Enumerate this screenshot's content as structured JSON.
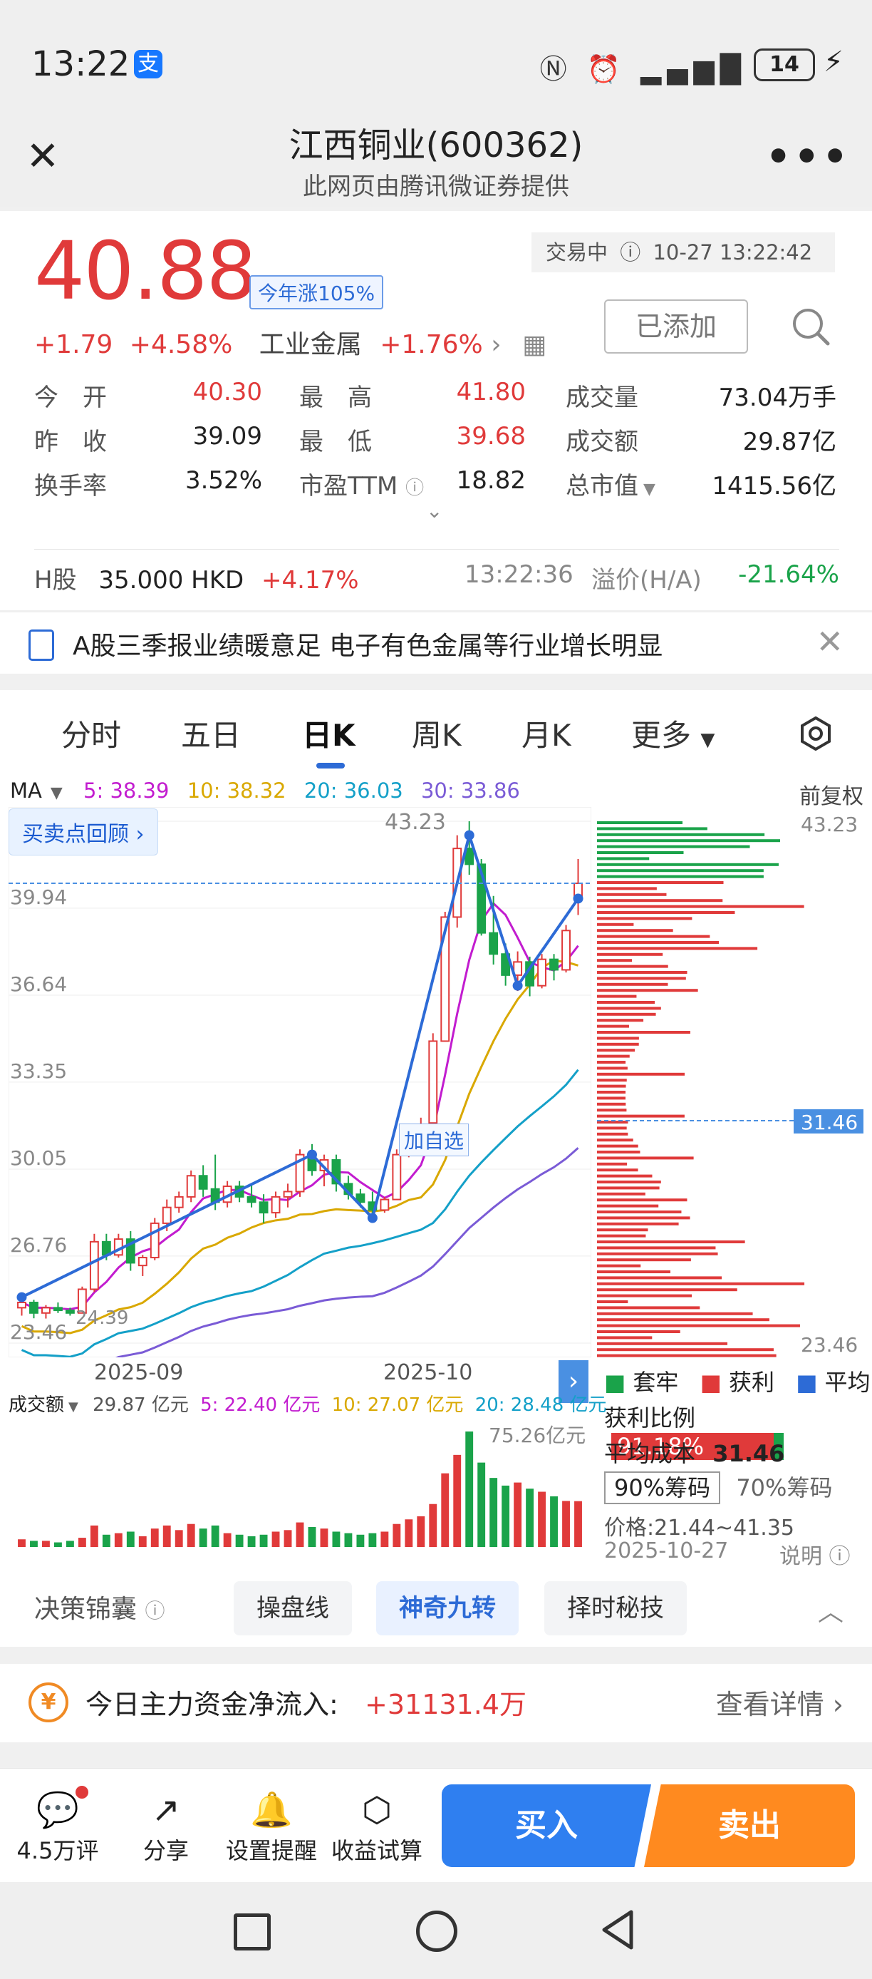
{
  "status_bar": {
    "time": "13:22",
    "app_badge": "支",
    "battery": "14"
  },
  "header": {
    "title": "江西铜业(600362)",
    "subtitle": "此网页由腾讯微证券提供"
  },
  "quote": {
    "price": "40.88",
    "ytd": "今年涨105%",
    "status": "交易中",
    "datetime": "10-27 13:22:42",
    "change": "+1.79",
    "change_pct": "+4.58%",
    "sector": "工业金属",
    "sector_pct": "+1.76%",
    "added_label": "已添加",
    "stats": [
      {
        "label": "今　开",
        "value": "40.30",
        "color": "red"
      },
      {
        "label": "最　高",
        "value": "41.80",
        "color": "red"
      },
      {
        "label": "成交量",
        "value": "73.04万手",
        "color": "black"
      },
      {
        "label": "昨　收",
        "value": "39.09",
        "color": "black"
      },
      {
        "label": "最　低",
        "value": "39.68",
        "color": "red"
      },
      {
        "label": "成交额",
        "value": "29.87亿",
        "color": "black"
      },
      {
        "label": "换手率",
        "value": "3.52%",
        "color": "black"
      },
      {
        "label": "市盈TTM",
        "value": "18.82",
        "color": "black"
      },
      {
        "label": "总市值",
        "value": "1415.56亿",
        "color": "black"
      }
    ],
    "h_share": {
      "label": "H股",
      "price": "35.000 HKD",
      "pct": "+4.17%",
      "time": "13:22:36",
      "premium_label": "溢价(H/A)",
      "premium": "-21.64%"
    }
  },
  "news": {
    "text": "A股三季报业绩暖意足 电子有色金属等行业增长明显"
  },
  "chart_tabs": [
    "分时",
    "五日",
    "日K",
    "周K",
    "月K",
    "更多"
  ],
  "ma": {
    "label": "MA",
    "ma5": "5: 38.39",
    "ma10": "10: 38.32",
    "ma20": "20: 36.03",
    "ma30": "30: 33.86"
  },
  "adjust": "前复权",
  "replay": "买卖点回顾 ›",
  "y_ticks": [
    "43.23",
    "39.94",
    "36.64",
    "33.35",
    "30.05",
    "26.76",
    "23.46"
  ],
  "x_ticks": [
    "2025-09",
    "2025-10"
  ],
  "chart_marks": {
    "low_label": "24.39",
    "high_label": "43.23",
    "watch_label": "加自选"
  },
  "dist_ticks": {
    "top": "43.23",
    "avg": "31.46",
    "bottom": "23.46"
  },
  "volume": {
    "label": "成交额",
    "total": "29.87 亿元",
    "v5": "5: 22.40 亿元",
    "v10": "10: 27.07 亿元",
    "v20": "20: 28.48 亿元",
    "max": "75.26亿元"
  },
  "distribution": {
    "legend": [
      "套牢",
      "获利",
      "平均"
    ],
    "profit_label": "获利比例",
    "profit_value": "91.18%",
    "avg_cost_label": "平均成本",
    "avg_cost_value": "31.46",
    "chip90": "90%筹码",
    "chip70": "70%筹码",
    "price_range": "价格:21.44~41.35",
    "date": "2025-10-27",
    "explain": "说明"
  },
  "tools": {
    "label": "决策锦囊",
    "pills": [
      "操盘线",
      "神奇九转",
      "择时秘技"
    ]
  },
  "flow": {
    "label": "今日主力资金净流入:",
    "value": "+31131.4万",
    "detail": "查看详情 ›"
  },
  "bottom": {
    "items": [
      {
        "label": "4.5万评",
        "icon": "comment-icon"
      },
      {
        "label": "分享",
        "icon": "share-icon"
      },
      {
        "label": "设置提醒",
        "icon": "bell-icon"
      },
      {
        "label": "收益试算",
        "icon": "yen-calc-icon"
      }
    ],
    "buy": "买入",
    "sell": "卖出"
  },
  "colors": {
    "up": "#e03a3a",
    "down": "#1aa34a",
    "accent": "#2d6bd6",
    "sell": "#ff8a1f"
  },
  "chart_data": {
    "type": "candlestick",
    "y_range": [
      23.46,
      43.23
    ],
    "x_ticks": [
      "2025-09",
      "2025-10"
    ],
    "candles": [
      [
        24.8,
        25.2,
        24.5,
        25.0
      ],
      [
        25.0,
        25.1,
        24.4,
        24.6
      ],
      [
        24.6,
        24.9,
        24.39,
        24.8
      ],
      [
        24.8,
        25.0,
        24.6,
        24.7
      ],
      [
        24.7,
        24.8,
        24.5,
        24.6
      ],
      [
        24.6,
        25.6,
        24.6,
        25.5
      ],
      [
        25.5,
        27.6,
        25.4,
        27.3
      ],
      [
        27.3,
        27.6,
        26.6,
        26.8
      ],
      [
        26.8,
        27.6,
        26.7,
        27.4
      ],
      [
        27.4,
        27.7,
        26.2,
        26.5
      ],
      [
        26.4,
        26.8,
        26.0,
        26.7
      ],
      [
        26.7,
        28.2,
        26.6,
        28.0
      ],
      [
        28.0,
        28.9,
        27.7,
        28.6
      ],
      [
        28.6,
        29.2,
        28.4,
        29.0
      ],
      [
        29.0,
        30.0,
        28.8,
        29.8
      ],
      [
        29.8,
        30.2,
        29.0,
        29.3
      ],
      [
        29.3,
        30.6,
        28.5,
        28.8
      ],
      [
        28.8,
        29.6,
        28.6,
        29.4
      ],
      [
        29.4,
        29.6,
        28.8,
        29.0
      ],
      [
        29.0,
        29.5,
        28.6,
        28.8
      ],
      [
        28.8,
        29.1,
        28.0,
        28.4
      ],
      [
        28.4,
        29.2,
        28.2,
        29.0
      ],
      [
        29.0,
        29.5,
        28.6,
        29.2
      ],
      [
        29.2,
        30.8,
        29.0,
        30.6
      ],
      [
        30.6,
        31.0,
        29.8,
        30.0
      ],
      [
        30.0,
        30.6,
        29.4,
        30.4
      ],
      [
        30.4,
        30.6,
        29.2,
        29.5
      ],
      [
        29.5,
        29.8,
        28.9,
        29.1
      ],
      [
        29.1,
        29.3,
        28.6,
        28.8
      ],
      [
        28.8,
        29.2,
        28.2,
        28.5
      ],
      [
        28.5,
        29.0,
        28.4,
        28.9
      ],
      [
        28.9,
        30.8,
        28.9,
        30.6
      ],
      [
        30.6,
        31.6,
        30.5,
        31.4
      ],
      [
        31.4,
        32.0,
        30.8,
        31.6
      ],
      [
        31.8,
        35.2,
        31.8,
        34.9
      ],
      [
        34.9,
        39.8,
        34.9,
        39.6
      ],
      [
        39.6,
        42.7,
        39.2,
        42.2
      ],
      [
        42.2,
        43.23,
        41.2,
        41.6
      ],
      [
        41.6,
        41.8,
        38.9,
        39.0
      ],
      [
        39.0,
        40.4,
        37.8,
        38.2
      ],
      [
        38.2,
        38.6,
        37.0,
        37.4
      ],
      [
        37.4,
        38.3,
        36.8,
        37.9
      ],
      [
        37.9,
        38.1,
        36.6,
        37.0
      ],
      [
        37.0,
        38.2,
        36.9,
        38.0
      ],
      [
        38.0,
        38.2,
        37.2,
        37.6
      ],
      [
        37.6,
        39.3,
        37.5,
        39.09
      ],
      [
        40.3,
        41.8,
        39.68,
        40.88
      ]
    ],
    "volume_max": 75.26,
    "volumes": [
      5,
      4,
      4,
      3,
      4,
      6,
      14,
      8,
      9,
      10,
      7,
      12,
      14,
      11,
      15,
      12,
      14,
      9,
      8,
      7,
      8,
      10,
      11,
      16,
      13,
      12,
      10,
      9,
      8,
      9,
      10,
      15,
      18,
      20,
      28,
      48,
      60,
      75.26,
      55,
      45,
      40,
      42,
      38,
      36,
      33,
      30,
      29.87
    ]
  }
}
